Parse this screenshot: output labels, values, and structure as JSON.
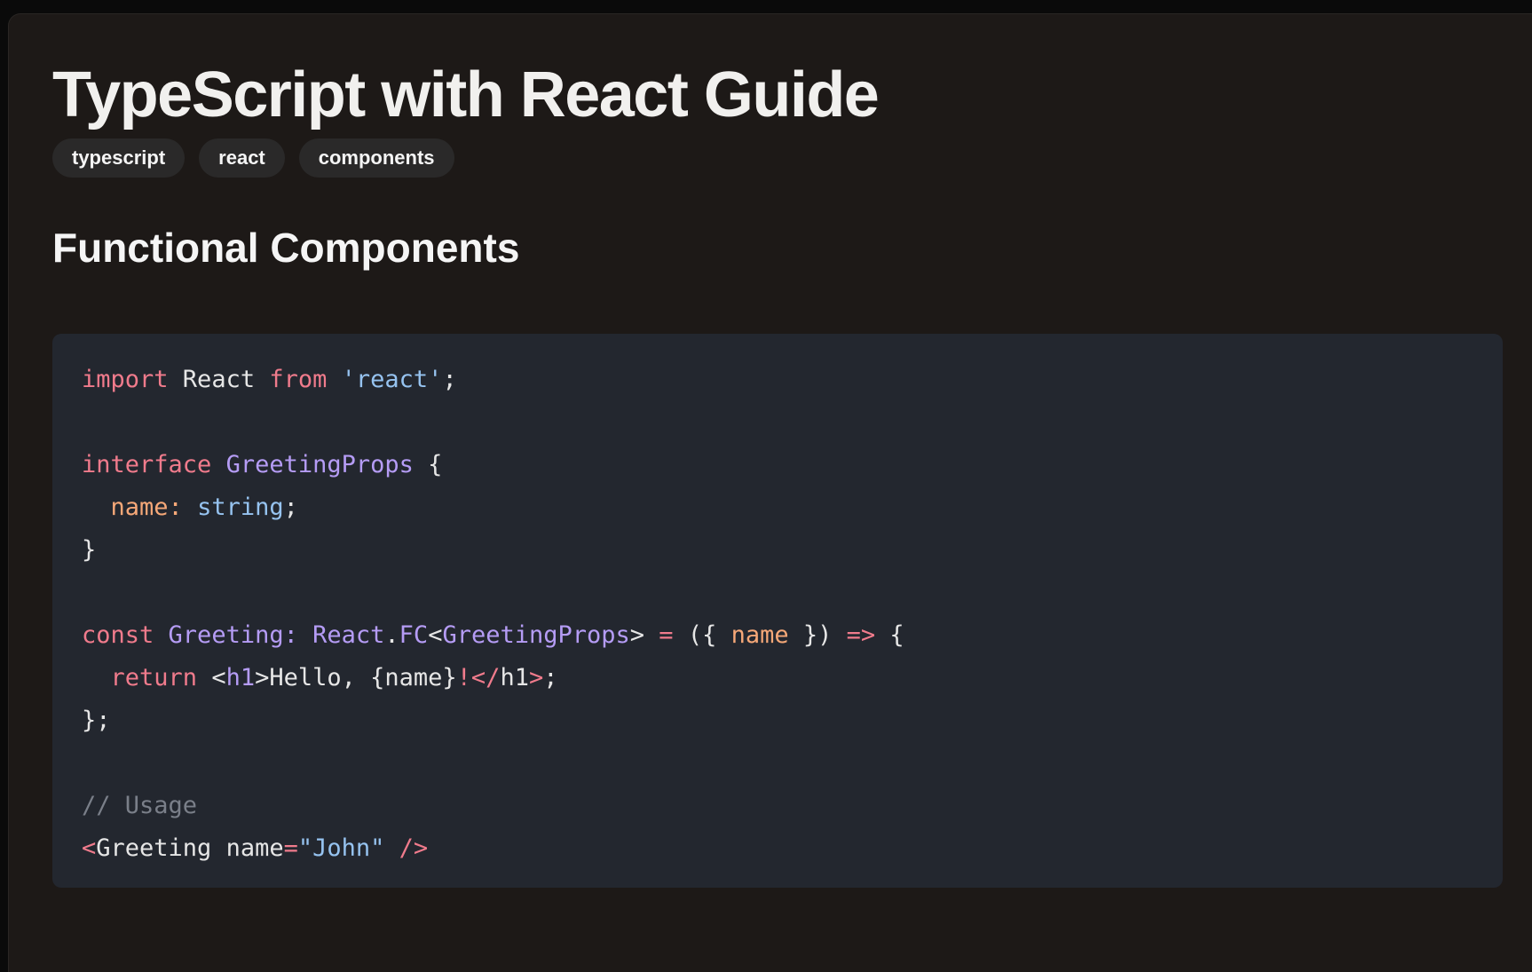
{
  "article": {
    "title": "TypeScript with React Guide",
    "tags": [
      "typescript",
      "react",
      "components"
    ],
    "section_heading": "Functional Components"
  },
  "code": {
    "lines": [
      [
        {
          "t": "import",
          "c": "kw"
        },
        {
          "t": " React ",
          "c": "plain"
        },
        {
          "t": "from",
          "c": "kw"
        },
        {
          "t": " ",
          "c": "plain"
        },
        {
          "t": "'react'",
          "c": "str"
        },
        {
          "t": ";",
          "c": "plain"
        }
      ],
      [],
      [
        {
          "t": "interface",
          "c": "kw"
        },
        {
          "t": " ",
          "c": "plain"
        },
        {
          "t": "GreetingProps",
          "c": "type"
        },
        {
          "t": " {",
          "c": "plain"
        }
      ],
      [
        {
          "t": "  ",
          "c": "plain"
        },
        {
          "t": "name:",
          "c": "prop"
        },
        {
          "t": " ",
          "c": "plain"
        },
        {
          "t": "string",
          "c": "str"
        },
        {
          "t": ";",
          "c": "plain"
        }
      ],
      [
        {
          "t": "}",
          "c": "plain"
        }
      ],
      [],
      [
        {
          "t": "const",
          "c": "kw"
        },
        {
          "t": " ",
          "c": "plain"
        },
        {
          "t": "Greeting:",
          "c": "type"
        },
        {
          "t": " ",
          "c": "plain"
        },
        {
          "t": "React",
          "c": "type"
        },
        {
          "t": ".",
          "c": "plain"
        },
        {
          "t": "FC",
          "c": "type"
        },
        {
          "t": "<",
          "c": "plain"
        },
        {
          "t": "GreetingProps",
          "c": "type"
        },
        {
          "t": "> ",
          "c": "plain"
        },
        {
          "t": "=",
          "c": "kw"
        },
        {
          "t": " ({ ",
          "c": "plain"
        },
        {
          "t": "name",
          "c": "prop"
        },
        {
          "t": " }) ",
          "c": "plain"
        },
        {
          "t": "=>",
          "c": "kw"
        },
        {
          "t": " {",
          "c": "plain"
        }
      ],
      [
        {
          "t": "  ",
          "c": "plain"
        },
        {
          "t": "return",
          "c": "kw"
        },
        {
          "t": " <",
          "c": "plain"
        },
        {
          "t": "h1",
          "c": "type"
        },
        {
          "t": ">Hello, {name}",
          "c": "plain"
        },
        {
          "t": "!</",
          "c": "kw"
        },
        {
          "t": "h1",
          "c": "plain"
        },
        {
          "t": ">",
          "c": "kw"
        },
        {
          "t": ";",
          "c": "plain"
        }
      ],
      [
        {
          "t": "};",
          "c": "plain"
        }
      ],
      [],
      [
        {
          "t": "// Usage",
          "c": "comment"
        }
      ],
      [
        {
          "t": "<",
          "c": "kw"
        },
        {
          "t": "Greeting name",
          "c": "plain"
        },
        {
          "t": "=",
          "c": "kw"
        },
        {
          "t": "\"John\"",
          "c": "str"
        },
        {
          "t": " ",
          "c": "plain"
        },
        {
          "t": "/>",
          "c": "kw"
        }
      ]
    ]
  },
  "colors": {
    "background": "#1d1917",
    "code_background": "#23272f",
    "keyword": "#f07b8c",
    "string": "#96c3f0",
    "type": "#b59cf5",
    "property": "#f6a878",
    "comment": "#7a7f89",
    "tag_background": "#2a2929"
  }
}
